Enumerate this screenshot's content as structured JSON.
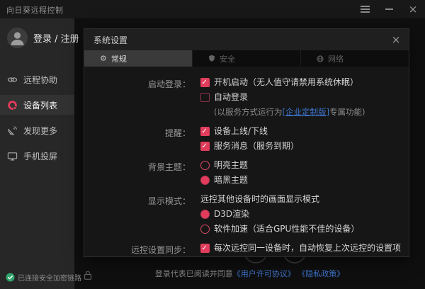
{
  "window": {
    "title": "向日葵远程控制"
  },
  "sidebar": {
    "login_label": "登录 / 注册",
    "items": [
      {
        "label": "远程协助"
      },
      {
        "label": "设备列表"
      },
      {
        "label": "发现更多"
      },
      {
        "label": "手机投屏"
      }
    ],
    "connection_status": "已连接安全加密链路"
  },
  "footer": {
    "agreement_prefix": "登录代表已阅读并同意",
    "license_link": "《用户许可协议》",
    "privacy_link": "《隐私政策》"
  },
  "dialog": {
    "title": "系统设置",
    "close_glyph": "×",
    "tabs": [
      {
        "label": "常规"
      },
      {
        "label": "安全"
      },
      {
        "label": "网络"
      }
    ],
    "startup": {
      "label": "启动登录：",
      "boot_option": "开机启动（无人值守请禁用系统休眠）",
      "autologin_option": "自动登录",
      "note_prefix": "(以服务方式运行为",
      "note_link": "[企业定制版]",
      "note_suffix": "专属功能)"
    },
    "remind": {
      "label": "提醒：",
      "online_option": "设备上线/下线",
      "service_option": "服务消息（服务到期）"
    },
    "theme": {
      "label": "背景主题：",
      "light_option": "明亮主题",
      "dark_option": "暗黑主题"
    },
    "display": {
      "label": "显示模式：",
      "desc": "远控其他设备时的画面显示模式",
      "d3d_option": "D3D渲染",
      "software_option": "软件加速（适合GPU性能不佳的设备）"
    },
    "sync": {
      "label": "远控设置同步：",
      "option": "每次远控同一设备时，自动恢复上次远控的设置项"
    }
  },
  "colors": {
    "accent_pink": "#e23c5c",
    "link_blue": "#3e74cd",
    "status_green": "#2fa46a"
  }
}
